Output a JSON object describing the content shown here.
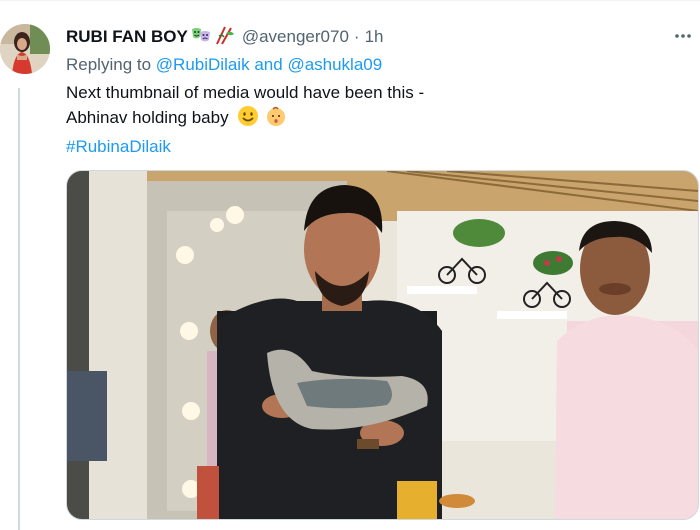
{
  "tweet": {
    "display_name": "RUBI FAN BOY",
    "handle": "@avenger070",
    "separator": "·",
    "time": "1h",
    "replying_label": "Replying to",
    "replying_mention_1": "@RubiDilaik",
    "replying_and": "and",
    "replying_mention_2": "@ashukla09",
    "text_line_1": "Next thumbnail of media would have been this -",
    "text_line_2": "Abhinav holding baby",
    "hashtag": "#RubinaDilaik",
    "icons": [
      "theater-masks-emoji",
      "chopsticks-emoji",
      "smiling-face-emoji",
      "baby-face-emoji",
      "more-options-icon"
    ]
  },
  "colors": {
    "link": "#1d9bf0",
    "secondary_text": "#536471",
    "primary_text": "#0f1419",
    "border": "#cfd9de"
  }
}
